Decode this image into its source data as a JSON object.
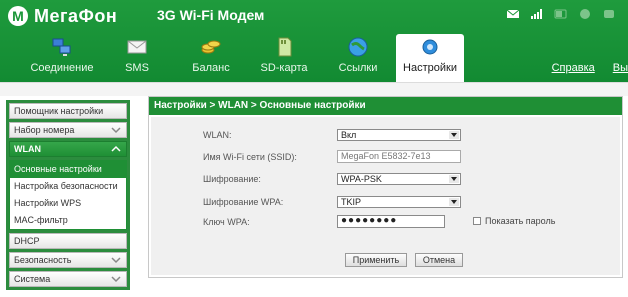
{
  "header": {
    "brand": "МегаФон",
    "brand_letter": "M",
    "product": "3G Wi-Fi Модем"
  },
  "nav": {
    "items": [
      {
        "label": "Соединение",
        "icon": "computers-icon"
      },
      {
        "label": "SMS",
        "icon": "envelope-icon"
      },
      {
        "label": "Баланс",
        "icon": "coins-icon"
      },
      {
        "label": "SD-карта",
        "icon": "sd-card-icon"
      },
      {
        "label": "Ссылки",
        "icon": "globe-icon"
      },
      {
        "label": "Настройки",
        "icon": "gears-icon"
      }
    ],
    "active": "Настройки"
  },
  "links": {
    "help": "Справка",
    "exit": "Вы"
  },
  "sidebar": {
    "items": [
      {
        "label": "Помощник настройки"
      },
      {
        "label": "Набор номера"
      },
      {
        "label": "WLAN"
      },
      {
        "label": "DHCP"
      },
      {
        "label": "Безопасность"
      },
      {
        "label": "Система"
      }
    ],
    "wlan_sub": [
      {
        "label": "Основные настройки"
      },
      {
        "label": "Настройка безопасности"
      },
      {
        "label": "Настройки WPS"
      },
      {
        "label": "MAC-фильтр"
      }
    ]
  },
  "main": {
    "title": "Настройки > WLAN > Основные настройки",
    "fields": {
      "wlan_label": "WLAN:",
      "wlan_value": "Вкл",
      "ssid_label": "Имя Wi-Fi сети (SSID):",
      "ssid_value": "MegaFon E5832-7e13",
      "encryption_label": "Шифрование:",
      "encryption_value": "WPA-PSK",
      "wpa_encryption_label": "Шифрование WPA:",
      "wpa_encryption_value": "TKIP",
      "wpa_key_label": "Ключ WPA:",
      "wpa_key_value": "●●●●●●●●",
      "show_password_label": "Показать пароль"
    },
    "buttons": {
      "apply": "Применить",
      "cancel": "Отмена"
    }
  },
  "colors": {
    "brand_green": "#1a9638",
    "accent_green": "#1f8f35"
  }
}
